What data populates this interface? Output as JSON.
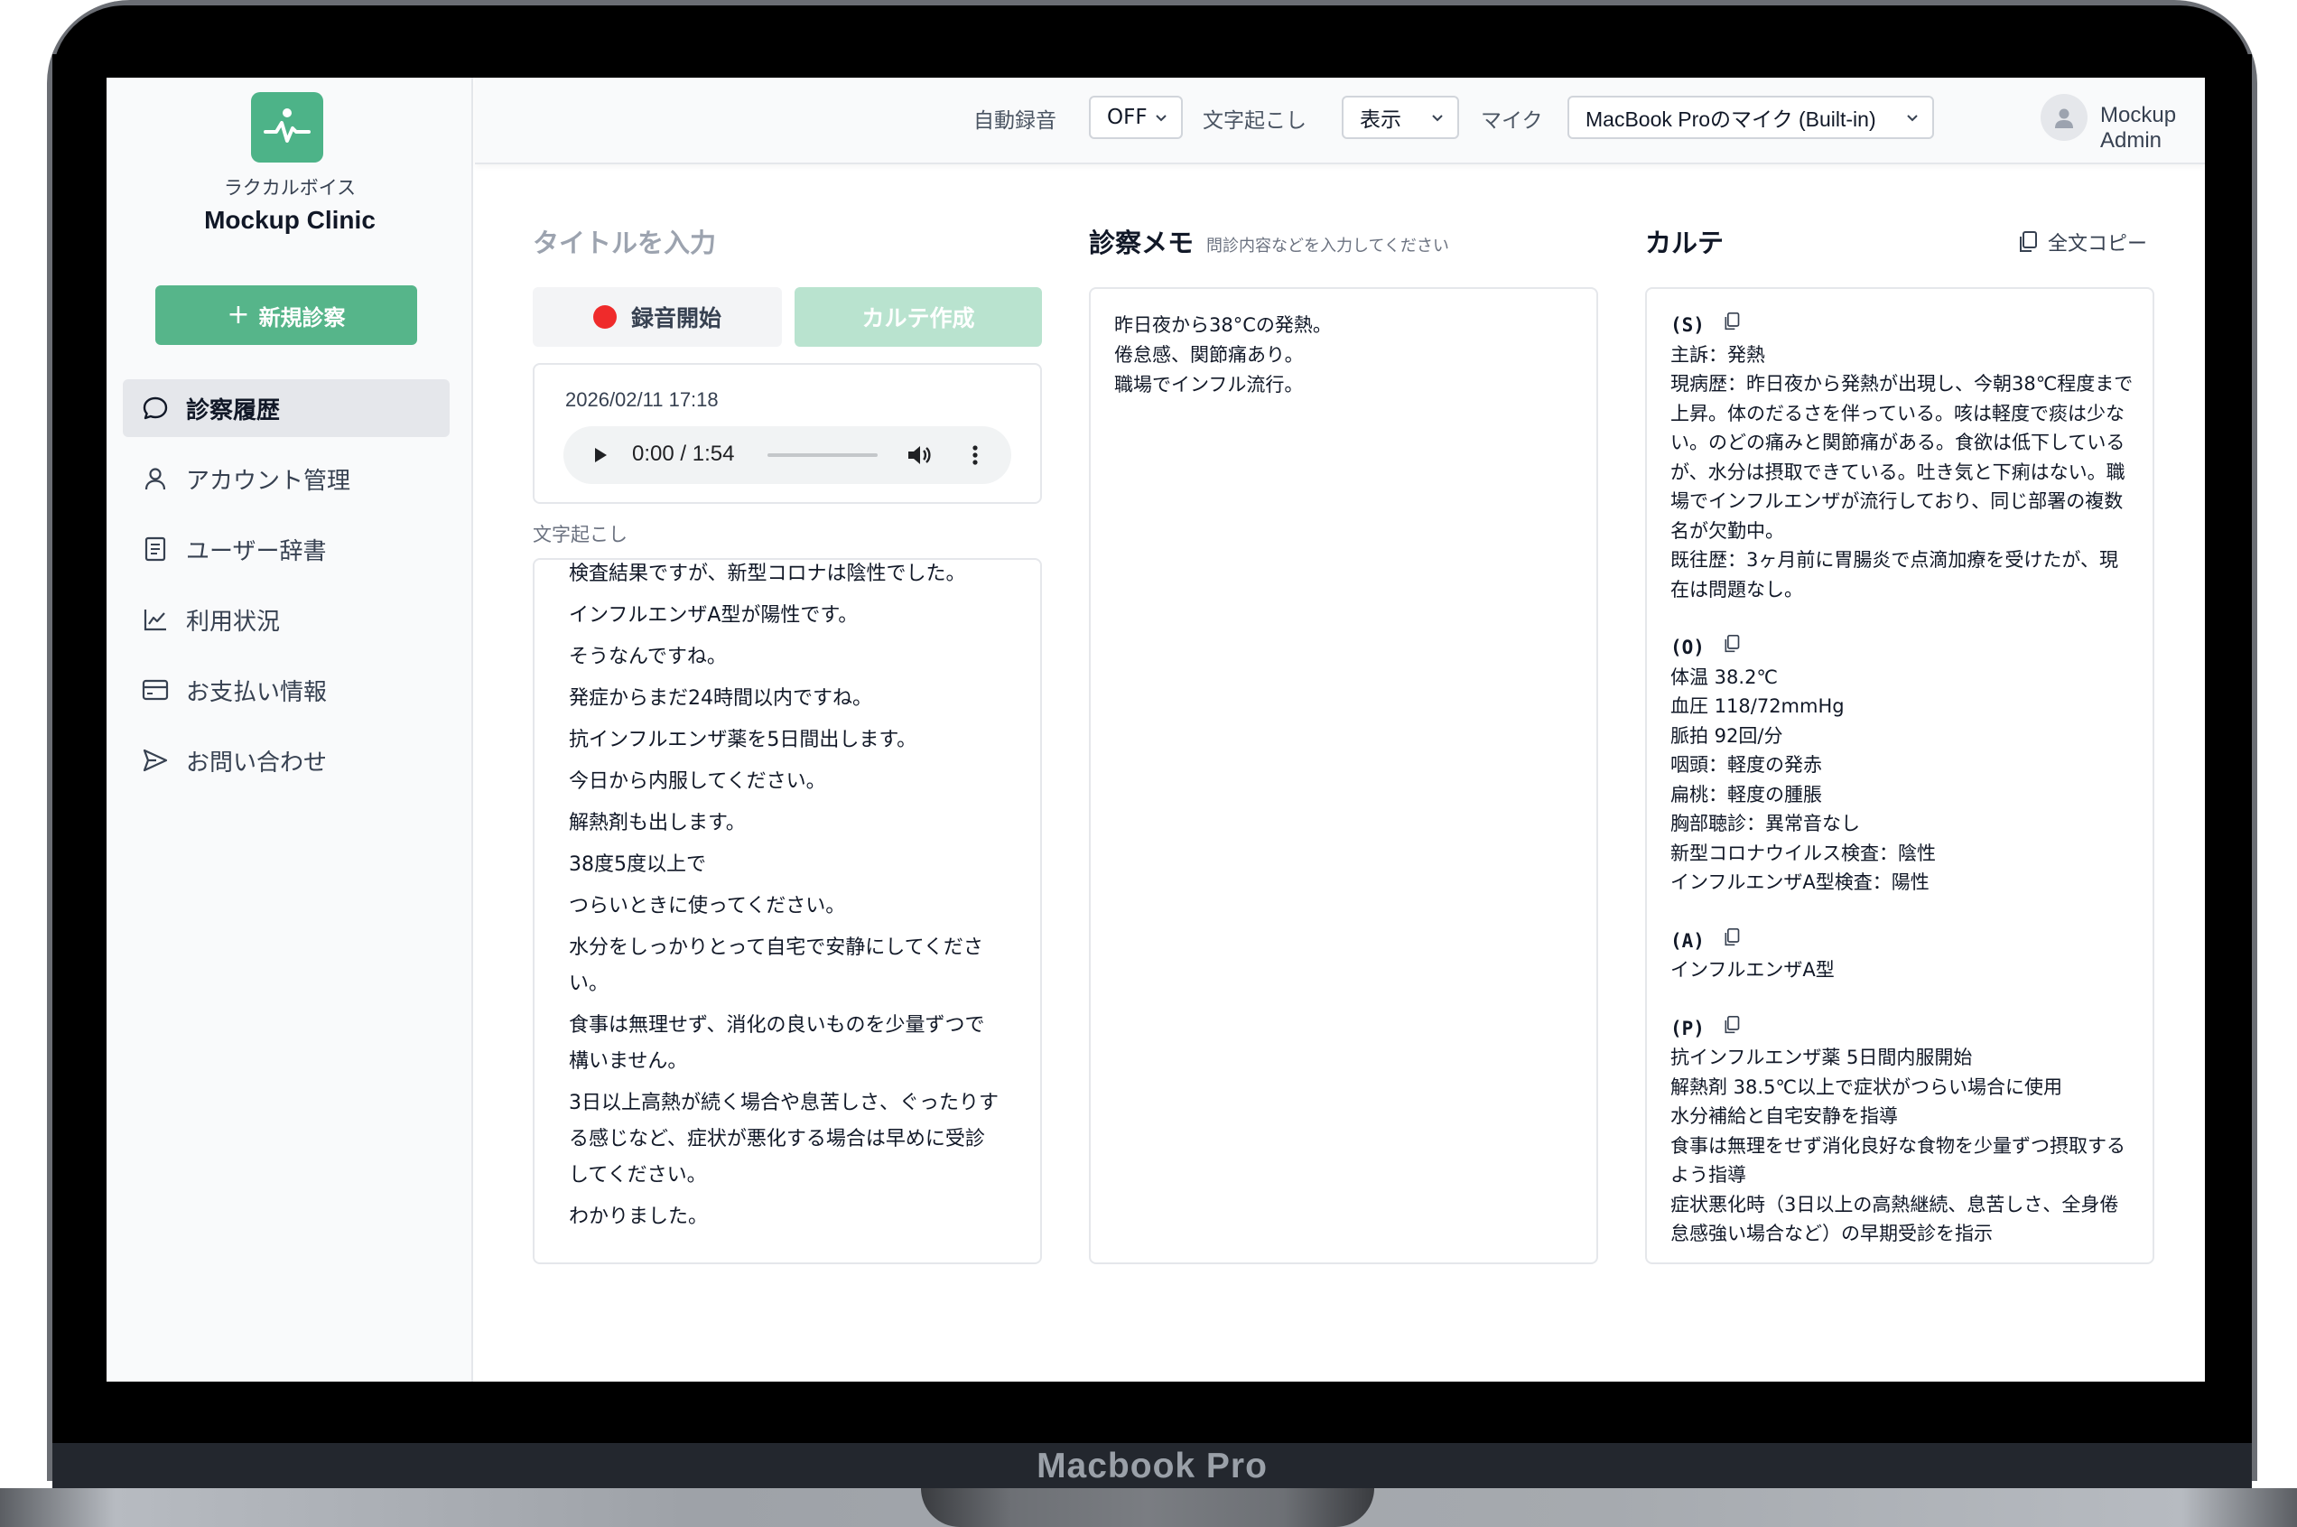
{
  "device_label": "Macbook Pro",
  "sidebar": {
    "brand_sub": "ラクカルボイス",
    "brand_name": "Mockup Clinic",
    "new_button": "新規診察",
    "items": [
      {
        "label": "診察履歴",
        "icon": "chat-bubble-icon"
      },
      {
        "label": "アカウント管理",
        "icon": "user-icon"
      },
      {
        "label": "ユーザー辞書",
        "icon": "document-icon"
      },
      {
        "label": "利用状況",
        "icon": "line-chart-icon"
      },
      {
        "label": "お支払い情報",
        "icon": "credit-card-icon"
      },
      {
        "label": "お問い合わせ",
        "icon": "send-icon"
      }
    ]
  },
  "topbar": {
    "auto_rec_label": "自動録音",
    "auto_rec_value": "OFF",
    "transcript_label": "文字起こし",
    "transcript_value": "表示",
    "mic_label": "マイク",
    "mic_value": "MacBook Proのマイク (Built-in)",
    "user_name": "Mockup Admin"
  },
  "session": {
    "title_placeholder": "タイトルを入力",
    "record_button": "録音開始",
    "karte_button": "カルテ作成",
    "audio_date": "2026/02/11 17:18",
    "audio_time": "0:00 / 1:54",
    "audio_progress": 0.0,
    "transcript_label": "文字起こし",
    "transcript": [
      "検査結果ですが、新型コロナは陰性でした。",
      "インフルエンザA型が陽性です。",
      "そうなんですね。",
      "発症からまだ24時間以内ですね。",
      "抗インフルエンザ薬を5日間出します。",
      "今日から内服してください。",
      "解熱剤も出します。",
      "38度5度以上で",
      "つらいときに使ってください。",
      "水分をしっかりとって自宅で安静にしてください。",
      "食事は無理せず、消化の良いものを少量ずつで構いません。",
      "3日以上高熱が続く場合や息苦しさ、ぐったりする感じなど、症状が悪化する場合は早めに受診してください。",
      "わかりました。"
    ]
  },
  "memo": {
    "title": "診察メモ",
    "hint": "問診内容などを入力してください",
    "lines": [
      "昨日夜から38°Cの発熱。",
      "倦怠感、関節痛あり。",
      "職場でインフル流行。"
    ]
  },
  "karte": {
    "title": "カルテ",
    "copy_all": "全文コピー",
    "sections": [
      {
        "head": "(S)",
        "lines": [
          "主訴：発熱",
          "現病歴：昨日夜から発熱が出現し、今朝38℃程度まで上昇。体のだるさを伴っている。咳は軽度で痰は少ない。のどの痛みと関節痛がある。食欲は低下しているが、水分は摂取できている。吐き気と下痢はない。職場でインフルエンザが流行しており、同じ部署の複数名が欠勤中。",
          "既往歴：3ヶ月前に胃腸炎で点滴加療を受けたが、現在は問題なし。"
        ]
      },
      {
        "head": "(O)",
        "lines": [
          "体温 38.2℃",
          "血圧 118/72mmHg",
          "脈拍 92回/分",
          "咽頭：軽度の発赤",
          "扁桃：軽度の腫脹",
          "胸部聴診：異常音なし",
          "新型コロナウイルス検査：陰性",
          "インフルエンザA型検査：陽性"
        ]
      },
      {
        "head": "(A)",
        "lines": [
          "インフルエンザA型"
        ]
      },
      {
        "head": "(P)",
        "lines": [
          "抗インフルエンザ薬 5日間内服開始",
          "解熱剤 38.5℃以上で症状がつらい場合に使用",
          "水分補給と自宅安静を指導",
          "食事は無理をせず消化良好な食物を少量ずつ摂取するよう指導",
          "症状悪化時（3日以上の高熱継続、息苦しさ、全身倦怠感強い場合など）の早期受診を指示"
        ]
      }
    ]
  },
  "colors": {
    "brand_green": "#56b58a",
    "disabled_green": "#b9e3cf",
    "record_red": "#ef2b2b"
  }
}
